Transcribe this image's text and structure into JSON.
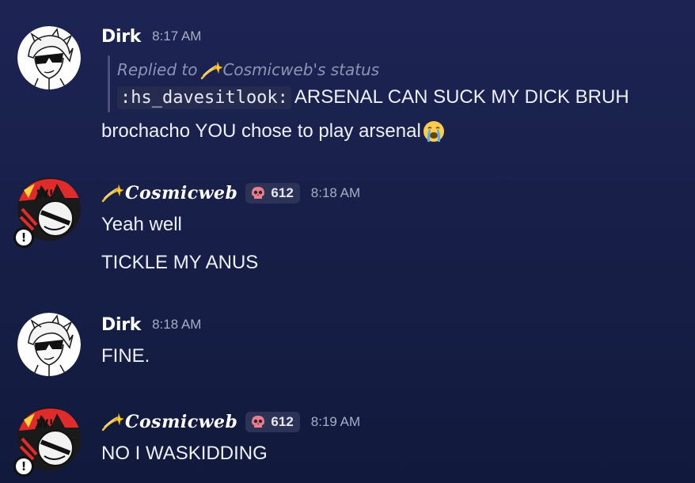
{
  "messages": [
    {
      "author": "Dirk",
      "timestamp": "8:17 AM",
      "avatar_icon": "white-haired-sunglasses-avatar",
      "reply": {
        "prefix": "Replied to",
        "target": "Cosmicweb's status",
        "target_icon": "dizzy-comet-icon",
        "code": ":hs_davesitlook:",
        "text": "ARSENAL CAN SUCK MY DICK BRUH"
      },
      "lines": [
        "brochacho YOU chose to play arsenal"
      ],
      "trailing_emoji": "loudly-crying-face-icon"
    },
    {
      "author": "Cosmicweb",
      "author_icon": "dizzy-comet-icon",
      "badge_icon": "skull-icon",
      "badge_count": "612",
      "timestamp": "8:18 AM",
      "avatar_icon": "red-black-cartoon-avatar",
      "status_icon": "exclamation-status-icon",
      "lines": [
        "Yeah well",
        "TICKLE MY ANUS"
      ]
    },
    {
      "author": "Dirk",
      "timestamp": "8:18 AM",
      "avatar_icon": "white-haired-sunglasses-avatar",
      "lines": [
        "FINE."
      ]
    },
    {
      "author": "Cosmicweb",
      "author_icon": "dizzy-comet-icon",
      "badge_icon": "skull-icon",
      "badge_count": "612",
      "timestamp": "8:19 AM",
      "avatar_icon": "red-black-cartoon-avatar",
      "status_icon": "exclamation-status-icon",
      "lines": [
        "NO I WASKIDDING"
      ]
    }
  ],
  "colors": {
    "background_top": "#1d2454",
    "background_bottom": "#111a3c",
    "timestamp": "#a9adc3",
    "reply_text": "#8e94b4",
    "badge_bg": "#2c3357",
    "skull": "#e87f8f"
  }
}
